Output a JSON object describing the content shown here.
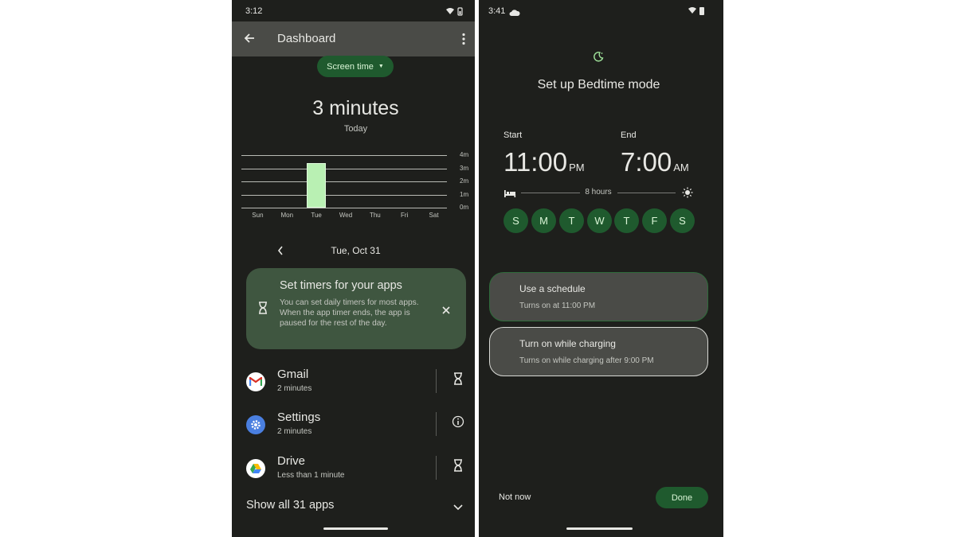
{
  "left_phone": {
    "status_time": "3:12",
    "header": {
      "title": "Dashboard"
    },
    "dropdown_label": "Screen time",
    "summary": {
      "total": "3 minutes",
      "period": "Today"
    },
    "chart_data": {
      "type": "bar",
      "categories": [
        "Sun",
        "Mon",
        "Tue",
        "Wed",
        "Thu",
        "Fri",
        "Sat"
      ],
      "values": [
        0,
        0,
        3.4,
        0,
        0,
        0,
        0
      ],
      "y_ticks": [
        "4m",
        "3m",
        "2m",
        "1m",
        "0m"
      ],
      "ylim": [
        0,
        4
      ],
      "grid": true,
      "bar_color": "#b9f0b3"
    },
    "date_nav": {
      "date": "Tue, Oct 31"
    },
    "tip_card": {
      "title": "Set timers for your apps",
      "body": "You can set daily timers for most apps. When the app timer ends, the app is paused for the rest of the day."
    },
    "apps": [
      {
        "name": "Gmail",
        "usage": "2 minutes",
        "icon": "gmail-icon",
        "action_icon": "hourglass-icon"
      },
      {
        "name": "Settings",
        "usage": "2 minutes",
        "icon": "settings-gear-icon",
        "action_icon": "info-icon"
      },
      {
        "name": "Drive",
        "usage": "Less than 1 minute",
        "icon": "drive-icon",
        "action_icon": "hourglass-icon"
      }
    ],
    "show_all": "Show all 31 apps"
  },
  "right_phone": {
    "status_time": "3:41",
    "title": "Set up Bedtime mode",
    "start": {
      "label": "Start",
      "time": "11:00",
      "ampm": "PM"
    },
    "end": {
      "label": "End",
      "time": "7:00",
      "ampm": "AM"
    },
    "duration": "8 hours",
    "days": [
      "S",
      "M",
      "T",
      "W",
      "T",
      "F",
      "S"
    ],
    "options": [
      {
        "title": "Use a schedule",
        "subtitle": "Turns on at 11:00 PM"
      },
      {
        "title": "Turn on while charging",
        "subtitle": "Turns on while charging after 9:00 PM"
      }
    ],
    "not_now": "Not now",
    "done": "Done"
  },
  "colors": {
    "accent_green": "#1f5a2e",
    "card_green": "#3f5640",
    "background": "#1e1f1c"
  }
}
